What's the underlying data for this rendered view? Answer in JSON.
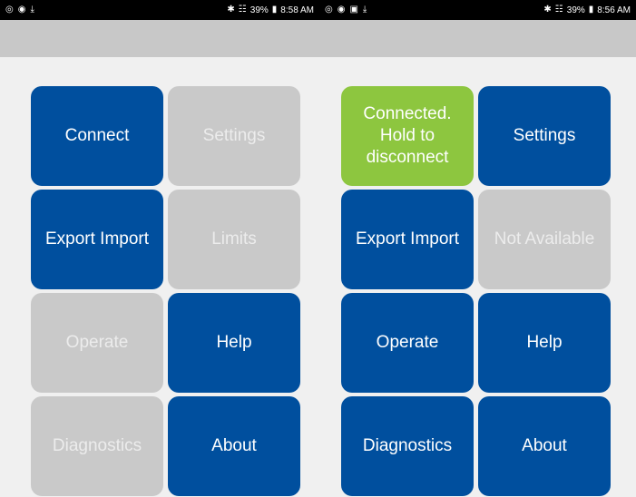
{
  "left_device": {
    "status_bar": {
      "left_icons": [
        "sync-icon",
        "shield-icon",
        "download-icon"
      ],
      "battery": "39%",
      "time": "8:58 AM"
    },
    "tiles": [
      {
        "label": "Connect",
        "state": "active"
      },
      {
        "label": "Settings",
        "state": "disabled"
      },
      {
        "label": "Export Import",
        "state": "active"
      },
      {
        "label": "Limits",
        "state": "disabled"
      },
      {
        "label": "Operate",
        "state": "disabled"
      },
      {
        "label": "Help",
        "state": "active"
      },
      {
        "label": "Diagnostics",
        "state": "disabled"
      },
      {
        "label": "About",
        "state": "active"
      }
    ]
  },
  "right_device": {
    "status_bar": {
      "left_icons": [
        "sync-icon",
        "shield-icon",
        "image-icon",
        "download-icon"
      ],
      "battery": "39%",
      "time": "8:56 AM"
    },
    "tiles": [
      {
        "label": "Connected.\nHold to\ndisconnect",
        "state": "connected"
      },
      {
        "label": "Settings",
        "state": "active"
      },
      {
        "label": "Export Import",
        "state": "active"
      },
      {
        "label": "Not Available",
        "state": "disabled"
      },
      {
        "label": "Operate",
        "state": "active"
      },
      {
        "label": "Help",
        "state": "active"
      },
      {
        "label": "Diagnostics",
        "state": "active"
      },
      {
        "label": "About",
        "state": "active"
      }
    ]
  },
  "colors": {
    "active": "#004f9e",
    "disabled": "#c9c9c9",
    "connected": "#8dc63f",
    "app_bar": "#c8c8c8",
    "background": "#f0f0f0"
  }
}
